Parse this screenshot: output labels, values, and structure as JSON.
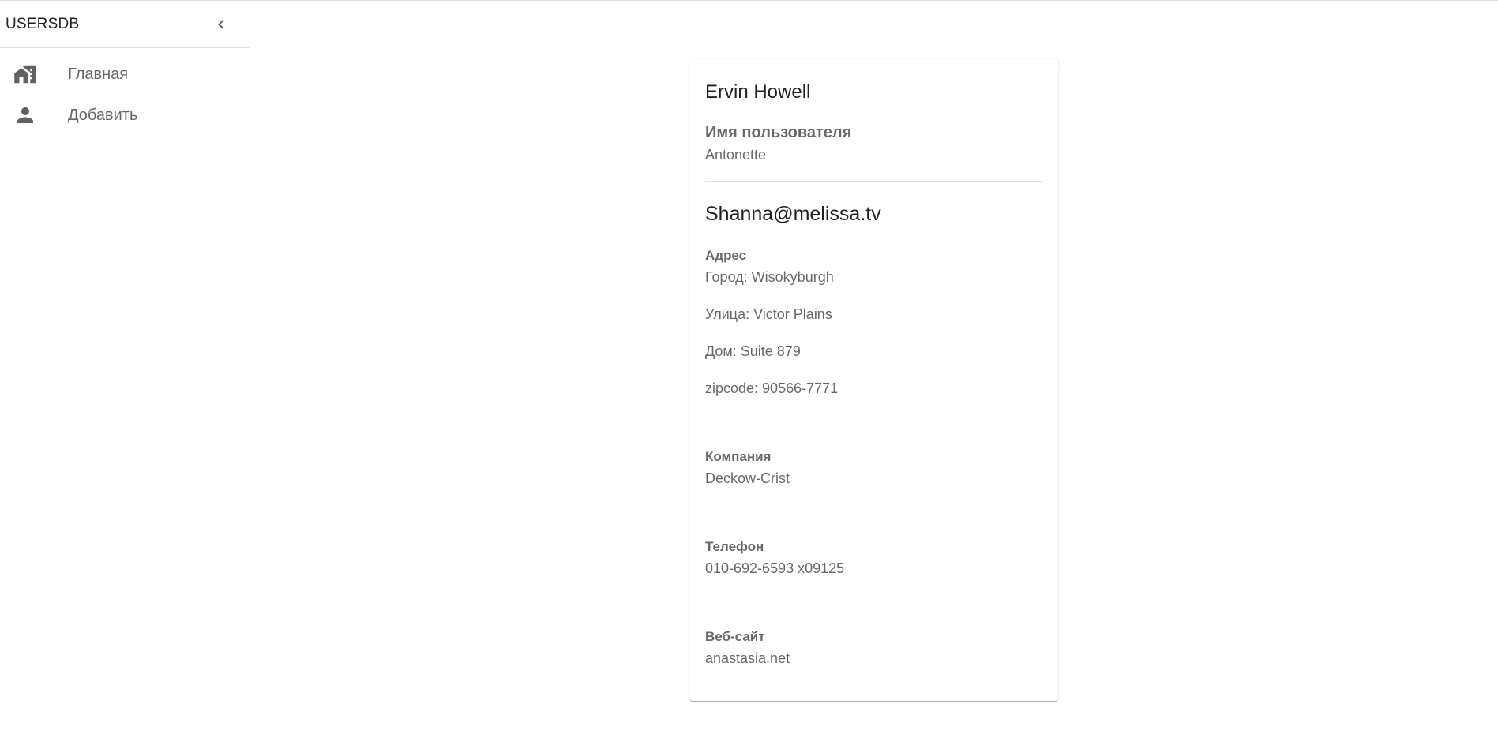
{
  "app": {
    "brand": "USERSDB"
  },
  "sidebar": {
    "items": [
      {
        "label": "Главная",
        "icon": "home-work-icon"
      },
      {
        "label": "Добавить",
        "icon": "person-icon"
      }
    ]
  },
  "user": {
    "name": "Ervin Howell",
    "username_label": "Имя пользователя",
    "username": "Antonette",
    "email": "Shanna@melissa.tv",
    "address_label": "Адрес",
    "city": "Город: Wisokyburgh",
    "street": "Улица: Victor Plains",
    "suite": "Дом: Suite 879",
    "zipcode": "zipcode: 90566-7771",
    "company_label": "Компания",
    "company": "Deckow-Crist",
    "phone_label": "Телефон",
    "phone": "010-692-6593 x09125",
    "website_label": "Веб-сайт",
    "website": "anastasia.net"
  },
  "colors": {
    "icon": "#616161",
    "divider": "#e0e0e0"
  }
}
